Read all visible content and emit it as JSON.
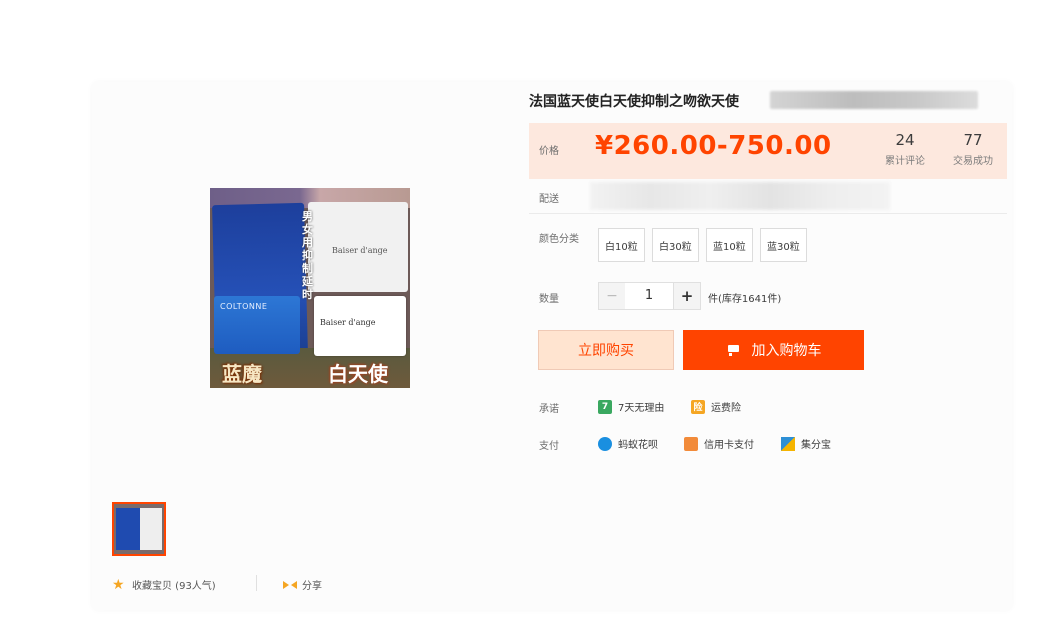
{
  "product": {
    "title": "法国蓝天使白天使抑制之吻欲天使",
    "price_label": "价格",
    "price": "¥260.00-750.00",
    "reviews_count": "24",
    "reviews_label": "累计评论",
    "sold_count": "77",
    "sold_label": "交易成功",
    "delivery_label": "配送",
    "color_label": "颜色分类",
    "sku_options": [
      "白10粒",
      "白30粒",
      "蓝10粒",
      "蓝30粒"
    ],
    "quantity_label": "数量",
    "quantity": "1",
    "qty_minus": "−",
    "qty_plus": "+",
    "stock_text": "件(库存1641件)",
    "buy_now_label": "立即购买",
    "add_cart_label": "加入购物车",
    "promise_label": "承诺",
    "promises": [
      "7天无理由",
      "运费险"
    ],
    "pay_label": "支付",
    "payments": [
      "蚂蚁花呗",
      "信用卡支付",
      "集分宝"
    ]
  },
  "gallery": {
    "caption_left": "蓝魔",
    "caption_right": "白天使",
    "vertical_text": "男女用抑制延时",
    "blue_brand": "COLTONNE",
    "white_pack_brand": "Baiser d'ange",
    "white_card_brand": "Baiser d'ange",
    "icon_badges": {
      "seven": "7",
      "ins": "险"
    }
  },
  "footer": {
    "favorite_label": "收藏宝贝 (93人气)",
    "share_label": "分享"
  },
  "colors": {
    "accent": "#ff4400",
    "price_bg": "#fde8de",
    "buy_now_bg": "#ffe4d0"
  }
}
